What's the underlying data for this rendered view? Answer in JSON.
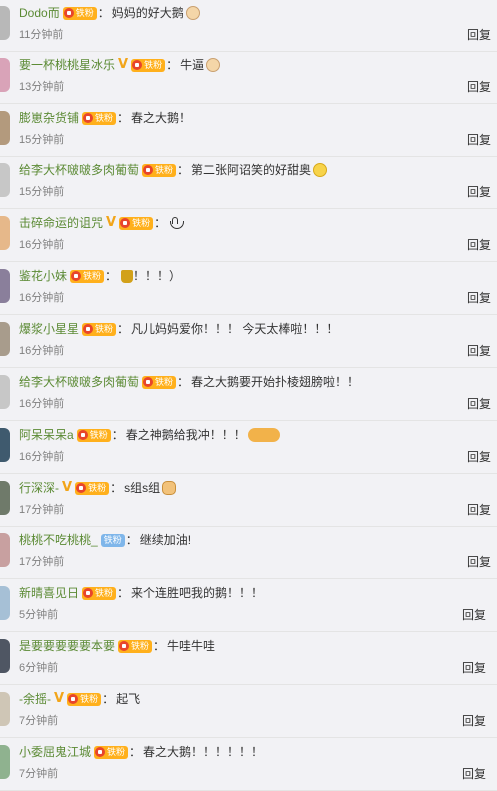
{
  "reply_label": "回复",
  "badge_label": "铁粉",
  "colon": "：",
  "comments": [
    {
      "user": "Dodo而",
      "verified": false,
      "badge": "gold",
      "text": "妈妈的好大鹅",
      "emoji": "doge-icon",
      "time": "11分钟前",
      "avatar_color": "#b8b8b8"
    },
    {
      "user": "要一杯桃桃星冰乐",
      "verified": true,
      "badge": "gold",
      "text": "牛逼",
      "emoji": "doge-icon",
      "time": "13分钟前",
      "avatar_color": "#d9a3b8"
    },
    {
      "user": "膨崽杂货铺",
      "verified": false,
      "badge": "gold",
      "text": "春之大鹅！",
      "emoji": "",
      "time": "15分钟前",
      "avatar_color": "#b39a7d"
    },
    {
      "user": "给李大杯啵啵多肉葡萄",
      "verified": false,
      "badge": "gold",
      "text": "第二张阿诏笑的好甜奥",
      "emoji": "laugh-icon",
      "time": "15分钟前",
      "avatar_color": "#c7c7c7"
    },
    {
      "user": "击碎命运的诅咒",
      "verified": true,
      "badge": "gold",
      "text": "",
      "emoji": "swan-icon",
      "time": "16分钟前",
      "avatar_color": "#e6b88a"
    },
    {
      "user": "鉴花小妹",
      "verified": false,
      "badge": "gold",
      "text": "！！！）",
      "emoji": "trophy-icon",
      "time": "16分钟前",
      "avatar_color": "#8a7f9b"
    },
    {
      "user": "爆浆小星星",
      "verified": false,
      "badge": "gold",
      "text": "凡儿妈妈爱你！！！ 今天太棒啦！！！",
      "emoji": "",
      "time": "16分钟前",
      "avatar_color": "#a89c8c"
    },
    {
      "user": "给李大杯啵啵多肉葡萄",
      "verified": false,
      "badge": "gold",
      "text": "春之大鹅要开始扑棱翅膀啦！！",
      "emoji": "",
      "time": "16分钟前",
      "avatar_color": "#c7c7c7"
    },
    {
      "user": "阿呆呆呆a",
      "verified": false,
      "badge": "gold",
      "text": "春之神鹅给我冲！！！",
      "emoji": "muscle-icon",
      "time": "16分钟前",
      "avatar_color": "#3f5a6e"
    },
    {
      "user": "行深深-",
      "verified": true,
      "badge": "gold",
      "text": "s组s组",
      "emoji": "fist-icon",
      "time": "17分钟前",
      "avatar_color": "#6f7a6a"
    },
    {
      "user": "桃桃不吃桃桃_",
      "verified": false,
      "badge": "blue",
      "text": "继续加油!",
      "emoji": "",
      "time": "17分钟前",
      "avatar_color": "#c8a0a0"
    },
    {
      "user": "新晴喜见日",
      "verified": false,
      "badge": "gold",
      "text": "来个连胜吧我的鹅！！！",
      "emoji": "",
      "time": "5分钟前",
      "avatar_color": "#a6c0d6"
    },
    {
      "user": "是要要要要要本要",
      "verified": false,
      "badge": "gold",
      "text": "牛哇牛哇",
      "emoji": "",
      "time": "6分钟前",
      "avatar_color": "#4f5663"
    },
    {
      "user": "-余摇-",
      "verified": true,
      "badge": "gold",
      "text": "起飞",
      "emoji": "",
      "time": "7分钟前",
      "avatar_color": "#cfc6b6"
    },
    {
      "user": "小委屈鬼江城",
      "verified": false,
      "badge": "gold",
      "text": "春之大鹅！！！！！！",
      "emoji": "",
      "time": "7分钟前",
      "avatar_color": "#8fb28f"
    }
  ]
}
